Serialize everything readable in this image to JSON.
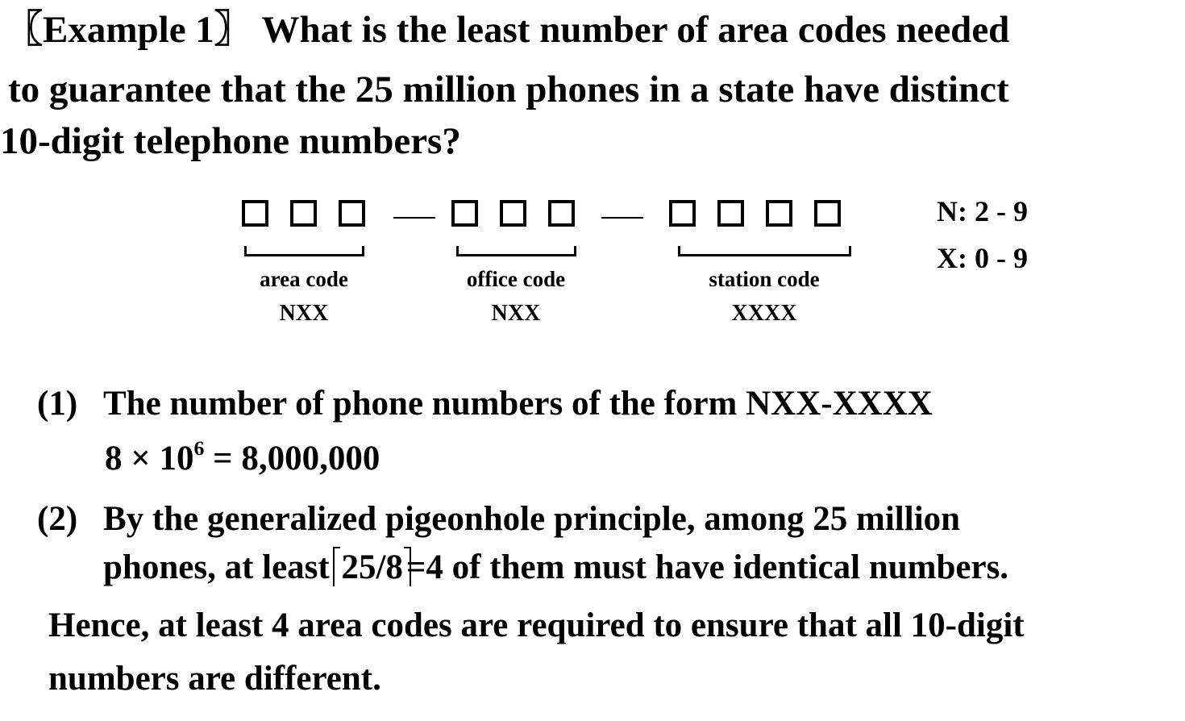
{
  "question": {
    "line1": "〖Example 1〗 What is the least number of area codes needed",
    "line2": "to guarantee that the 25 million phones in a state have distinct",
    "line3": "10-digit telephone numbers?"
  },
  "diagram": {
    "separator": "—",
    "area": {
      "label": "area code",
      "pattern": "NXX",
      "digits": 3
    },
    "office": {
      "label": "office code",
      "pattern": "NXX",
      "digits": 3
    },
    "station": {
      "label": "station code",
      "pattern": "XXXX",
      "digits": 4
    },
    "legend": {
      "n": "N: 2 - 9",
      "x": "X: 0 - 9"
    }
  },
  "step1": {
    "num": "(1)",
    "text": "The number of phone numbers of the form NXX-XXXX",
    "formula_base": "8 × 10",
    "formula_exp": "6",
    "formula_rest": " = 8,000,000"
  },
  "step2": {
    "num": "(2)",
    "line1": "By the generalized pigeonhole principle, among 25 million",
    "line2_pre": "phones, at least",
    "ceil_expr": "25/8",
    "line2_post": "=4 of them must have identical numbers."
  },
  "conclusion": {
    "line1": "Hence, at least 4 area codes are required to ensure that all 10-digit",
    "line2": "numbers are different."
  }
}
